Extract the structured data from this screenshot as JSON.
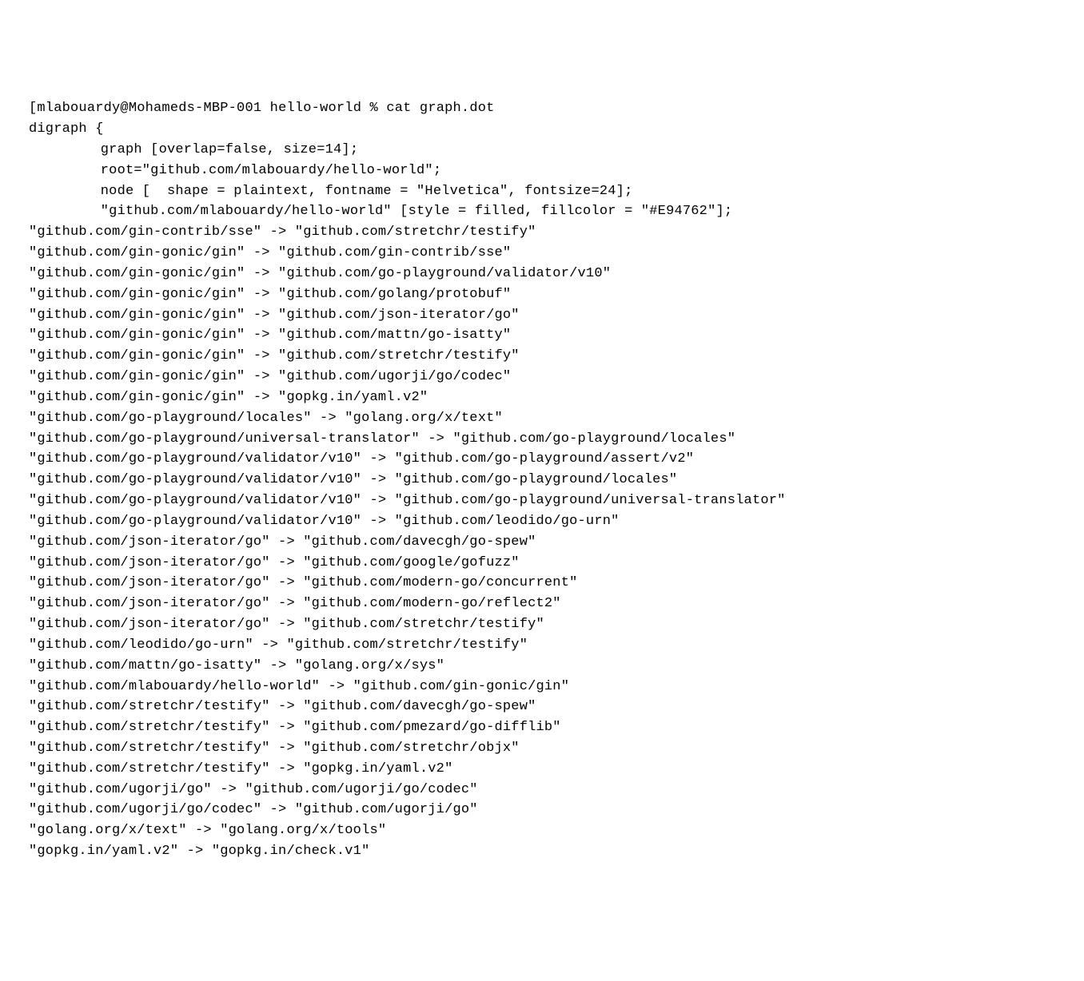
{
  "prompt": {
    "open_bracket": "[",
    "user_host": "mlabouardy@Mohameds-MBP-001",
    "cwd": "hello-world",
    "delim": "%",
    "command": "cat graph.dot"
  },
  "digraph_open": "digraph {",
  "graph_attr": "graph [overlap=false, size=14];",
  "root_attr": "root=\"github.com/mlabouardy/hello-world\";",
  "node_attr": "node [  shape = plaintext, fontname = \"Helvetica\", fontsize=24];",
  "highlight_node": "\"github.com/mlabouardy/hello-world\" [style = filled, fillcolor = \"#E94762\"];",
  "edges": [
    "\"github.com/gin-contrib/sse\" -> \"github.com/stretchr/testify\"",
    "\"github.com/gin-gonic/gin\" -> \"github.com/gin-contrib/sse\"",
    "\"github.com/gin-gonic/gin\" -> \"github.com/go-playground/validator/v10\"",
    "\"github.com/gin-gonic/gin\" -> \"github.com/golang/protobuf\"",
    "\"github.com/gin-gonic/gin\" -> \"github.com/json-iterator/go\"",
    "\"github.com/gin-gonic/gin\" -> \"github.com/mattn/go-isatty\"",
    "\"github.com/gin-gonic/gin\" -> \"github.com/stretchr/testify\"",
    "\"github.com/gin-gonic/gin\" -> \"github.com/ugorji/go/codec\"",
    "\"github.com/gin-gonic/gin\" -> \"gopkg.in/yaml.v2\"",
    "\"github.com/go-playground/locales\" -> \"golang.org/x/text\"",
    "\"github.com/go-playground/universal-translator\" -> \"github.com/go-playground/locales\"",
    "\"github.com/go-playground/validator/v10\" -> \"github.com/go-playground/assert/v2\"",
    "\"github.com/go-playground/validator/v10\" -> \"github.com/go-playground/locales\"",
    "\"github.com/go-playground/validator/v10\" -> \"github.com/go-playground/universal-translator\"",
    "\"github.com/go-playground/validator/v10\" -> \"github.com/leodido/go-urn\"",
    "\"github.com/json-iterator/go\" -> \"github.com/davecgh/go-spew\"",
    "\"github.com/json-iterator/go\" -> \"github.com/google/gofuzz\"",
    "\"github.com/json-iterator/go\" -> \"github.com/modern-go/concurrent\"",
    "\"github.com/json-iterator/go\" -> \"github.com/modern-go/reflect2\"",
    "\"github.com/json-iterator/go\" -> \"github.com/stretchr/testify\"",
    "\"github.com/leodido/go-urn\" -> \"github.com/stretchr/testify\"",
    "\"github.com/mattn/go-isatty\" -> \"golang.org/x/sys\"",
    "\"github.com/mlabouardy/hello-world\" -> \"github.com/gin-gonic/gin\"",
    "\"github.com/stretchr/testify\" -> \"github.com/davecgh/go-spew\"",
    "\"github.com/stretchr/testify\" -> \"github.com/pmezard/go-difflib\"",
    "\"github.com/stretchr/testify\" -> \"github.com/stretchr/objx\"",
    "\"github.com/stretchr/testify\" -> \"gopkg.in/yaml.v2\"",
    "\"github.com/ugorji/go\" -> \"github.com/ugorji/go/codec\"",
    "\"github.com/ugorji/go/codec\" -> \"github.com/ugorji/go\"",
    "\"golang.org/x/text\" -> \"golang.org/x/tools\"",
    "\"gopkg.in/yaml.v2\" -> \"gopkg.in/check.v1\""
  ]
}
